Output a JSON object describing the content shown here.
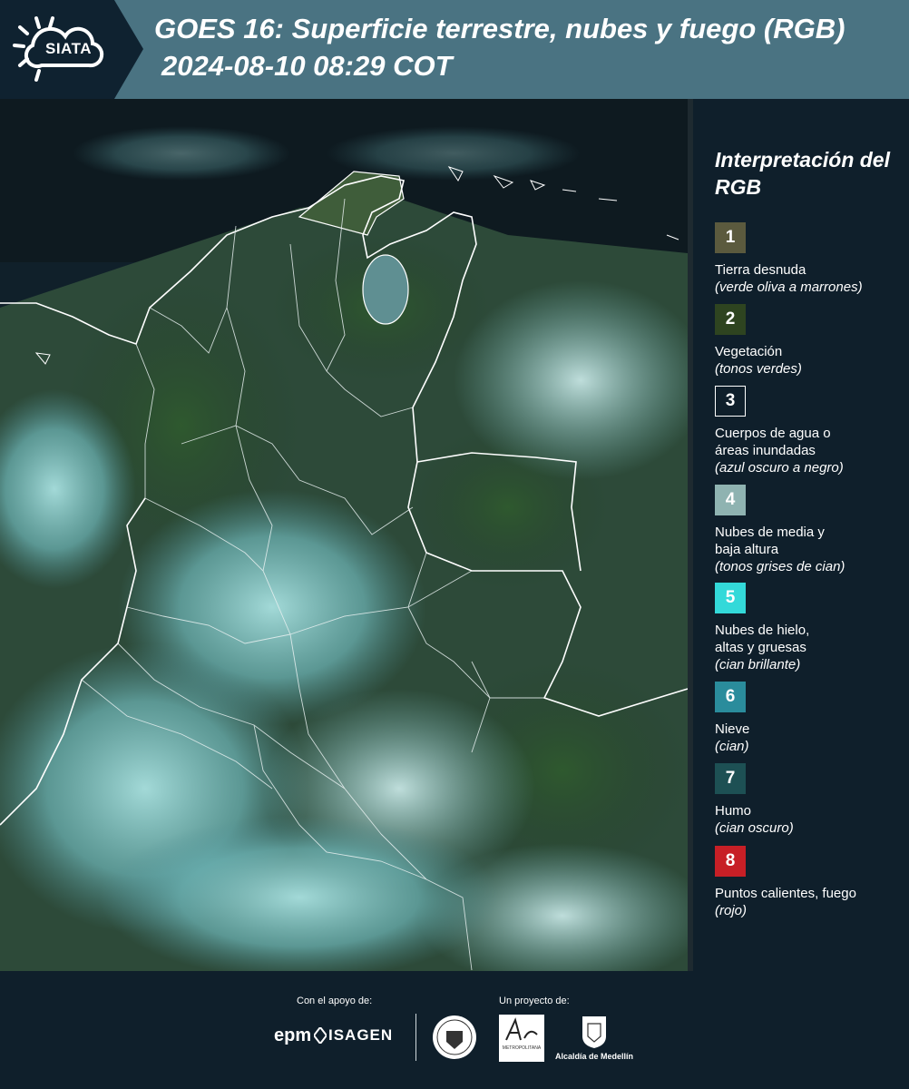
{
  "header": {
    "logo_text": "SIATA",
    "title_line1": "GOES 16: Superficie terrestre, nubes y fuego (RGB)",
    "title_line2": "2024-08-10 08:29 COT"
  },
  "legend": {
    "title": "Interpretación del RGB",
    "items": [
      {
        "number": "1",
        "color": "#5b5a3e",
        "label": "Tierra desnuda",
        "note": "(verde oliva a marrones)"
      },
      {
        "number": "2",
        "color": "#2e4420",
        "label": "Vegetación",
        "note": "(tonos verdes)"
      },
      {
        "number": "3",
        "color": "#0f1f2b",
        "label": "Cuerpos de agua o áreas inundadas",
        "note": "(azul oscuro a negro)"
      },
      {
        "number": "4",
        "color": "#8fb3b1",
        "label": "Nubes de media y baja altura",
        "note": "(tonos grises de cian)"
      },
      {
        "number": "5",
        "color": "#33d9d9",
        "label": "Nubes de hielo, altas y gruesas",
        "note": "(cian brillante)"
      },
      {
        "number": "6",
        "color": "#2a8c9c",
        "label": "Nieve",
        "note": "(cian)"
      },
      {
        "number": "7",
        "color": "#1d5054",
        "label": "Humo",
        "note": "(cian oscuro)"
      },
      {
        "number": "8",
        "color": "#c71f26",
        "label": "Puntos calientes, fuego",
        "note": "(rojo)"
      }
    ]
  },
  "footer": {
    "support_label": "Con el apoyo de:",
    "project_label": "Un proyecto de:",
    "sponsor_epm": "epm",
    "sponsor_isagen": "ISAGEN",
    "area_logo_text": "METROPOLITANA",
    "medellin_label": "Alcaldía de Medellín"
  }
}
